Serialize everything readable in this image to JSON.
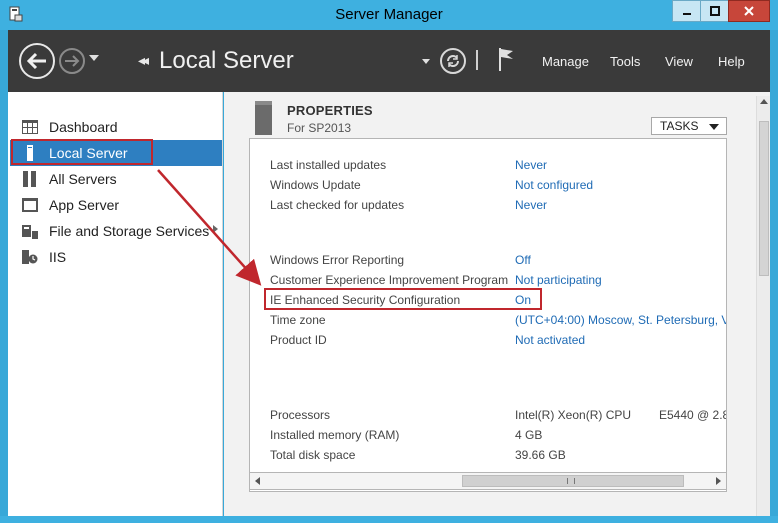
{
  "window": {
    "title": "Server Manager"
  },
  "header": {
    "page_title": "Local Server",
    "menu": [
      "Manage",
      "Tools",
      "View",
      "Help"
    ]
  },
  "sidebar": {
    "items": [
      {
        "label": "Dashboard",
        "icon": "dashboard-icon"
      },
      {
        "label": "Local Server",
        "icon": "server-icon"
      },
      {
        "label": "All Servers",
        "icon": "all-servers-icon"
      },
      {
        "label": "App Server",
        "icon": "app-server-icon"
      },
      {
        "label": "File and Storage Services",
        "icon": "file-storage-icon"
      },
      {
        "label": "IIS",
        "icon": "iis-icon"
      }
    ],
    "active_index": 1
  },
  "properties": {
    "title": "PROPERTIES",
    "subtitle": "For SP2013",
    "tasks_label": "TASKS",
    "groups": [
      [
        {
          "label": "Last installed updates",
          "value": "Never",
          "type": "link"
        },
        {
          "label": "Windows Update",
          "value": "Not configured",
          "type": "link"
        },
        {
          "label": "Last checked for updates",
          "value": "Never",
          "type": "link"
        }
      ],
      [
        {
          "label": "Windows Error Reporting",
          "value": "Off",
          "type": "link"
        },
        {
          "label": "Customer Experience Improvement Program",
          "value": "Not participating",
          "type": "link"
        },
        {
          "label": "IE Enhanced Security Configuration",
          "value": "On",
          "type": "link"
        },
        {
          "label": "Time zone",
          "value": "(UTC+04:00) Moscow, St. Petersburg, Vo",
          "type": "link"
        },
        {
          "label": "Product ID",
          "value": "Not activated",
          "type": "link"
        }
      ],
      [
        {
          "label": "Processors",
          "value": "Intel(R) Xeon(R) CPU",
          "extra": "E5440  @ 2.8",
          "type": "plain"
        },
        {
          "label": "Installed memory (RAM)",
          "value": "4 GB",
          "type": "plain"
        },
        {
          "label": "Total disk space",
          "value": "39.66 GB",
          "type": "plain"
        }
      ]
    ]
  },
  "colors": {
    "accent": "#2e7fc1",
    "link": "#1f6bb5",
    "highlight": "#c0272d",
    "header_bg": "#3a3a3a",
    "frame": "#3eb0e0"
  }
}
